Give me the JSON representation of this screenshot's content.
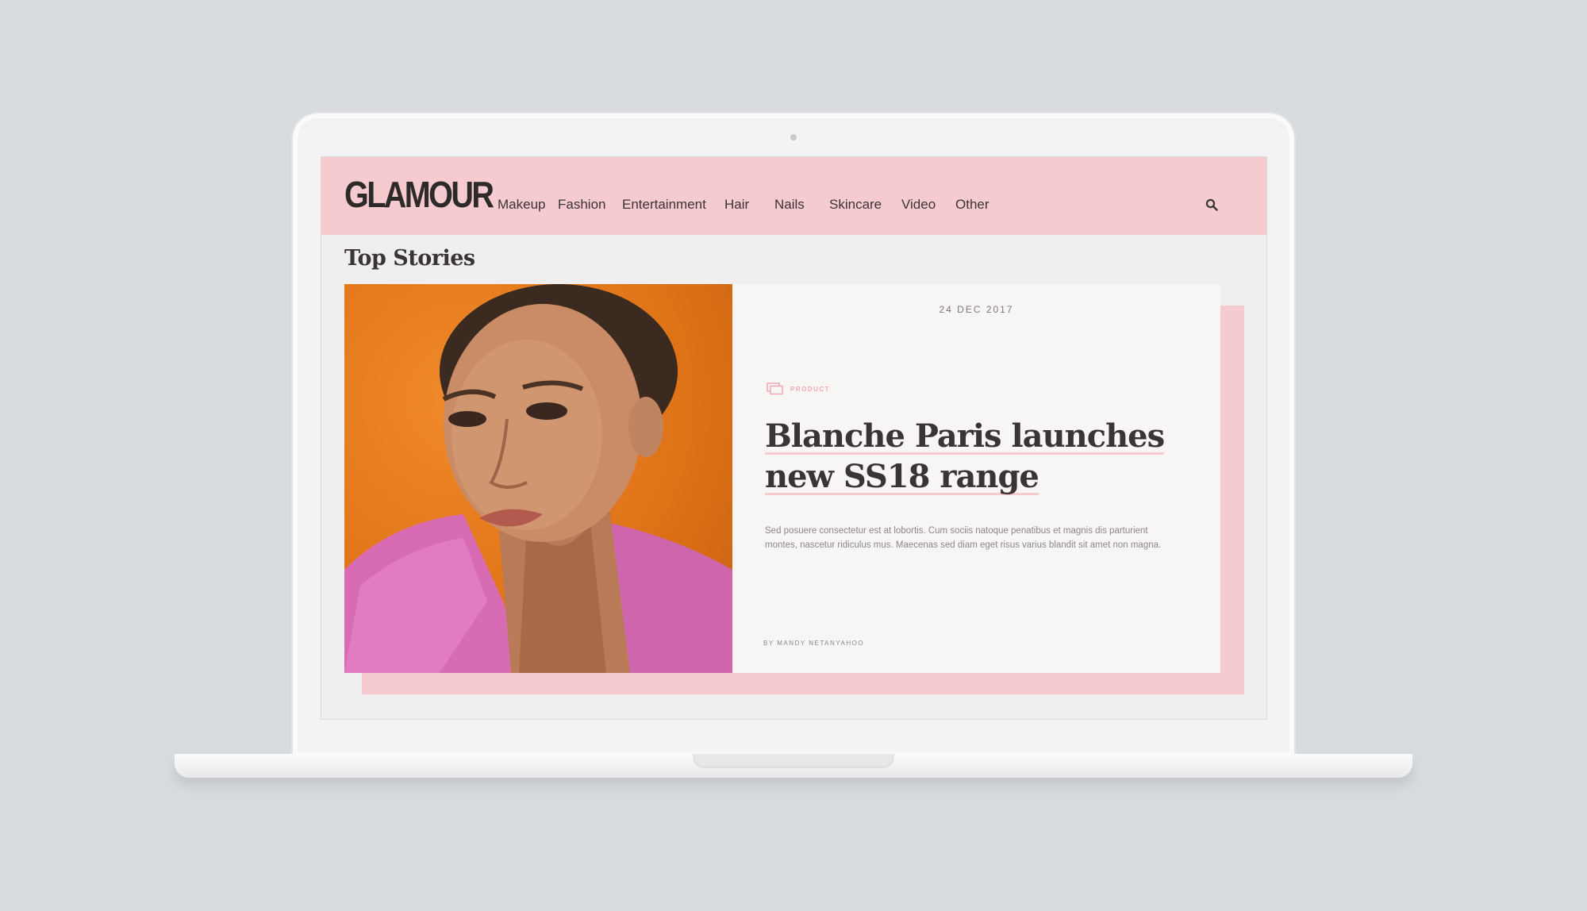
{
  "site": {
    "logo": "GLAMOUR",
    "nav": [
      {
        "label": "Makeup"
      },
      {
        "label": "Fashion"
      },
      {
        "label": "Entertainment"
      },
      {
        "label": "Hair"
      },
      {
        "label": "Nails"
      },
      {
        "label": "Skincare"
      },
      {
        "label": "Video"
      },
      {
        "label": "Other"
      }
    ],
    "search_icon": "search-icon"
  },
  "main": {
    "section_title": "Top Stories",
    "story": {
      "date": "24 DEC 2017",
      "category": "PRODUCT",
      "category_icon": "folder-icon",
      "headline_line1": "Blanche Paris launches",
      "headline_line2": "new SS18 range",
      "excerpt": "Sed posuere consectetur est at lobortis. Cum sociis natoque penatibus et magnis dis parturient montes, nascetur ridiculus mus. Maecenas sed diam eget risus varius blandit sit amet non magna.",
      "byline": "BY MANDY NETANYAHOO",
      "image": "portrait-photo"
    }
  },
  "colors": {
    "accent_pink": "#f5cbd0",
    "text_dark": "#3a3434",
    "background": "#d8dce0"
  }
}
